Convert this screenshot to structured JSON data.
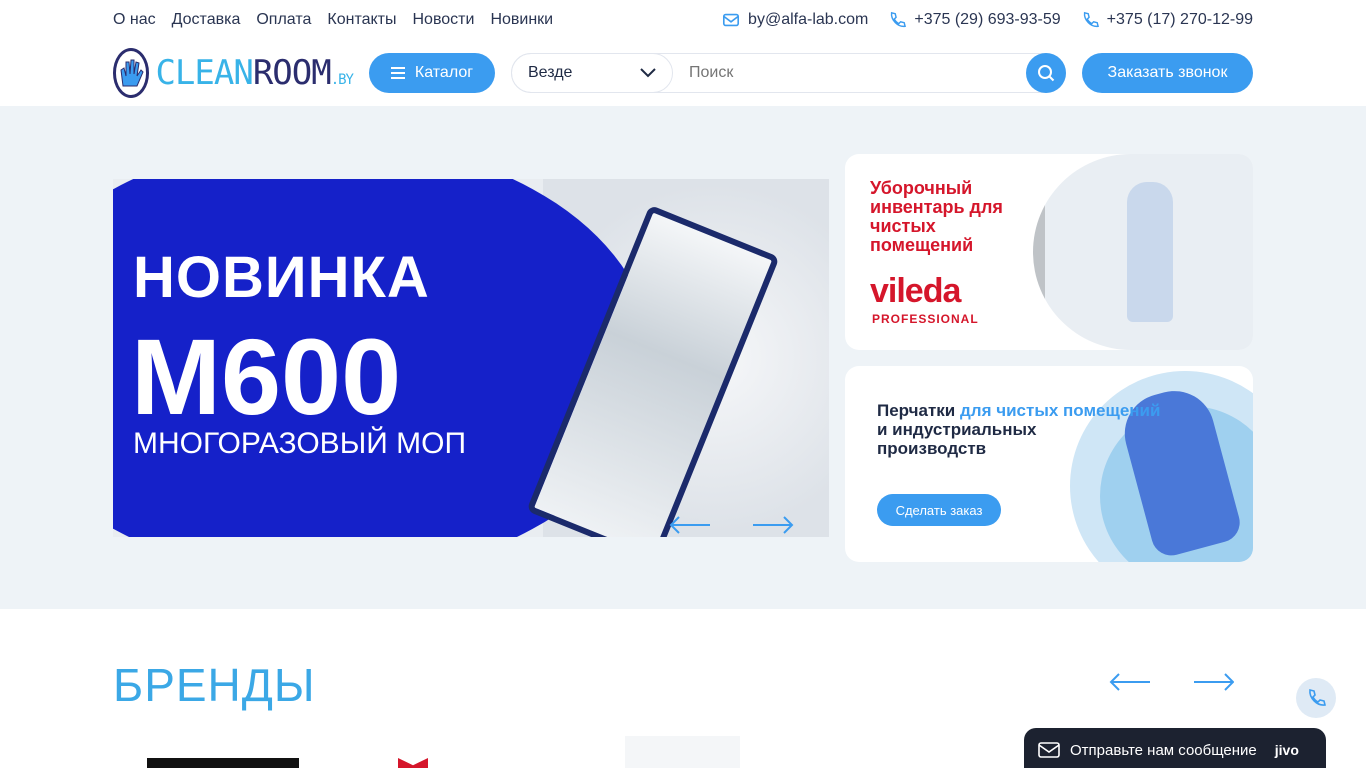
{
  "topnav": {
    "links": [
      "О нас",
      "Доставка",
      "Оплата",
      "Контакты",
      "Новости",
      "Новинки"
    ],
    "email": "by@alfa-lab.com",
    "phone1": "+375 (29) 693-93-59",
    "phone2": "+375 (17) 270-12-99"
  },
  "header": {
    "logo_main_1": "CLEAN",
    "logo_main_2": "ROOM",
    "logo_suffix": ".BY",
    "catalog_label": "Каталог",
    "search_scope": "Везде",
    "search_placeholder": "Поиск",
    "call_label": "Заказать звонок"
  },
  "slider": {
    "line1": "НОВИНКА",
    "line2": "М600",
    "line3": "МНОГОРАЗОВЫЙ МОП"
  },
  "banner1": {
    "title": "Уборочный инвентарь для чистых помещений",
    "brand": "vileda",
    "brand_sub": "PROFESSIONAL"
  },
  "banner2": {
    "title_part1": "Перчатки",
    "title_part2": "для чистых помещений",
    "title_part3": "и индустриальных производств",
    "button": "Сделать заказ"
  },
  "brands": {
    "title": "БРЕНДЫ"
  },
  "chat": {
    "label": "Отправьте нам сообщение",
    "brand": "jivo"
  },
  "colors": {
    "accent": "#3b9cf0",
    "brand_blue": "#1521c9",
    "vileda_red": "#d5162b"
  }
}
